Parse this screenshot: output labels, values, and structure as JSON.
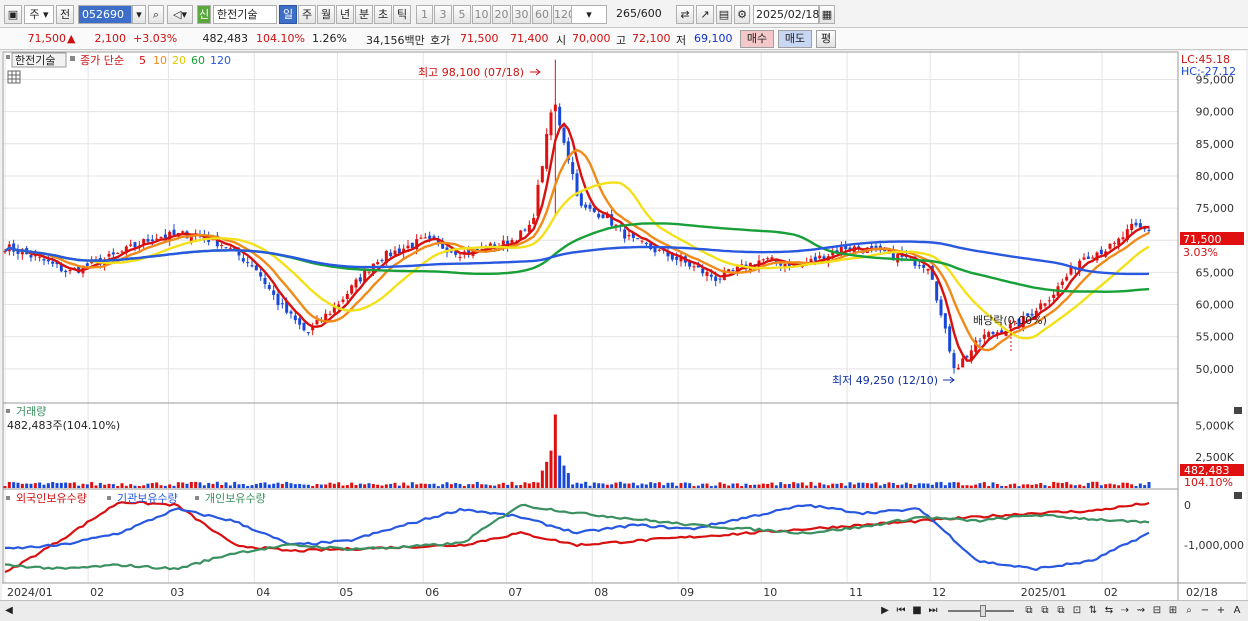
{
  "toolbar": {
    "period_label": "주",
    "prev_label": "전",
    "code": "052690",
    "badge": "신",
    "name": "한전기술",
    "periods": [
      "일",
      "주",
      "월",
      "년",
      "분",
      "초",
      "틱"
    ],
    "active_period": "일",
    "numbers": [
      "1",
      "3",
      "5",
      "10",
      "20",
      "30",
      "60",
      "120"
    ],
    "count": "265",
    "count_total": "/600",
    "date": "2025/02/18"
  },
  "quote": {
    "price": "71,500",
    "change": "2,100",
    "change_pct": "+3.03%",
    "volume": "482,483",
    "vol_ratio": "104.10%",
    "turnover": "1.26%",
    "amount": "34,156백만",
    "bid_label": "호가",
    "ask_price": "71,500",
    "bid_price": "71,400",
    "open_label": "시",
    "open": "70,000",
    "high_label": "고",
    "high": "72,100",
    "low_label": "저",
    "low": "69,100",
    "buy": "매수",
    "sell": "매도",
    "eval": "평"
  },
  "price_panel": {
    "name_tag": "한전기술",
    "legend_prefix": "종가 단순",
    "ma_labels": [
      "5",
      "10",
      "20",
      "60",
      "120"
    ],
    "max_annotation": "최고 98,100 (07/18)",
    "min_annotation": "최저 49,250 (12/10)",
    "dividend_annotation": "배당락(0.00%)",
    "lc": "LC:45.18",
    "hc": "HC:-27.12",
    "last_price_tag": "71,500",
    "last_pct_tag": "3.03%"
  },
  "volume_panel": {
    "title": "거래량",
    "value": "482,483주(104.10%)",
    "last_tag": "482,483",
    "last_pct": "104.10%"
  },
  "holding_panel": {
    "legend": [
      "외국인보유수량",
      "기관보유수량",
      "개인보유수량"
    ]
  },
  "colors": {
    "up": "#e01010",
    "down": "#1848d8",
    "ma5": "#d81010",
    "ma10": "#f08a18",
    "ma20": "#f4e018",
    "ma60": "#18a038",
    "ma120": "#2858e0",
    "foreign": "#d81010",
    "institution": "#2858e0",
    "individual": "#3a9060"
  },
  "chart_data": [
    {
      "type": "candlestick",
      "title": "한전기술",
      "period": "daily",
      "x_ticks": [
        "2024/01",
        "02",
        "03",
        "04",
        "05",
        "06",
        "07",
        "08",
        "09",
        "10",
        "11",
        "12",
        "2025/01",
        "02",
        "02/18"
      ],
      "y_ticks": [
        "50,000",
        "55,000",
        "60,000",
        "65,000",
        "70,000",
        "75,000",
        "80,000",
        "85,000",
        "90,000",
        "95,000"
      ],
      "ylim": [
        45000,
        98500
      ],
      "close_series": [
        [
          "2024-01-02",
          69000
        ],
        [
          "2024-01-15",
          67000
        ],
        [
          "2024-01-25",
          65000
        ],
        [
          "2024-02-10",
          67500
        ],
        [
          "2024-02-25",
          70500
        ],
        [
          "2024-03-10",
          71000
        ],
        [
          "2024-03-20",
          69500
        ],
        [
          "2024-04-01",
          66000
        ],
        [
          "2024-04-10",
          60000
        ],
        [
          "2024-04-20",
          55500
        ],
        [
          "2024-05-01",
          60000
        ],
        [
          "2024-05-15",
          67000
        ],
        [
          "2024-06-01",
          70000
        ],
        [
          "2024-06-15",
          68000
        ],
        [
          "2024-07-01",
          69500
        ],
        [
          "2024-07-10",
          72000
        ],
        [
          "2024-07-18",
          92000
        ],
        [
          "2024-07-28",
          75000
        ],
        [
          "2024-08-05",
          74000
        ],
        [
          "2024-08-15",
          70000
        ],
        [
          "2024-09-01",
          67000
        ],
        [
          "2024-09-15",
          64000
        ],
        [
          "2024-10-01",
          67000
        ],
        [
          "2024-10-15",
          66000
        ],
        [
          "2024-11-01",
          69000
        ],
        [
          "2024-11-15",
          68000
        ],
        [
          "2024-12-01",
          66000
        ],
        [
          "2024-12-05",
          58000
        ],
        [
          "2024-12-10",
          50000
        ],
        [
          "2024-12-20",
          55000
        ],
        [
          "2025-01-02",
          57000
        ],
        [
          "2025-01-15",
          62000
        ],
        [
          "2025-01-25",
          67500
        ],
        [
          "2025-02-05",
          69000
        ],
        [
          "2025-02-12",
          72000
        ],
        [
          "2025-02-18",
          71500
        ]
      ],
      "max": {
        "date": "07/18",
        "value": 98100
      },
      "min": {
        "date": "12/10",
        "value": 49250
      },
      "moving_averages": [
        5,
        10,
        20,
        60,
        120
      ]
    },
    {
      "type": "bar",
      "title": "거래량",
      "y_ticks": [
        "2,500K",
        "5,000K"
      ],
      "ylim": [
        0,
        6500
      ],
      "last_value": 482483,
      "spike": {
        "date": "2024-07-18",
        "value": 5900
      }
    },
    {
      "type": "line",
      "title": "외국인보유수량 / 기관보유수량 / 개인보유수량",
      "y_ticks": [
        "0",
        "-1,000,000"
      ],
      "ylim": [
        -1900000,
        350000
      ],
      "series": [
        {
          "name": "외국인보유수량",
          "values": [
            -1700000,
            -850000,
            80000,
            0,
            -1000000,
            -1150000,
            -1100000,
            -1050000,
            -1000000,
            -700000,
            -1000000,
            -900000,
            -800000,
            -700000,
            -600000,
            -500000,
            -400000,
            -300000,
            -200000,
            -150000,
            50000
          ]
        },
        {
          "name": "기관보유수량",
          "values": [
            -1100000,
            -1000000,
            -700000,
            -100000,
            -400000,
            -1000000,
            -900000,
            -500000,
            -100000,
            -300000,
            -700000,
            -500000,
            -600000,
            -300000,
            0,
            -200000,
            -100000,
            -1400000,
            -1600000,
            -1400000,
            -700000
          ]
        },
        {
          "name": "개인보유수량",
          "values": [
            -1500000,
            -1600000,
            -1500000,
            -1600000,
            -1200000,
            -1000000,
            -1100000,
            -1050000,
            -950000,
            0,
            -200000,
            -350000,
            -500000,
            -600000,
            -700000,
            -550000,
            -300000,
            -400000,
            -250000,
            -350000,
            -450000
          ]
        }
      ]
    }
  ]
}
